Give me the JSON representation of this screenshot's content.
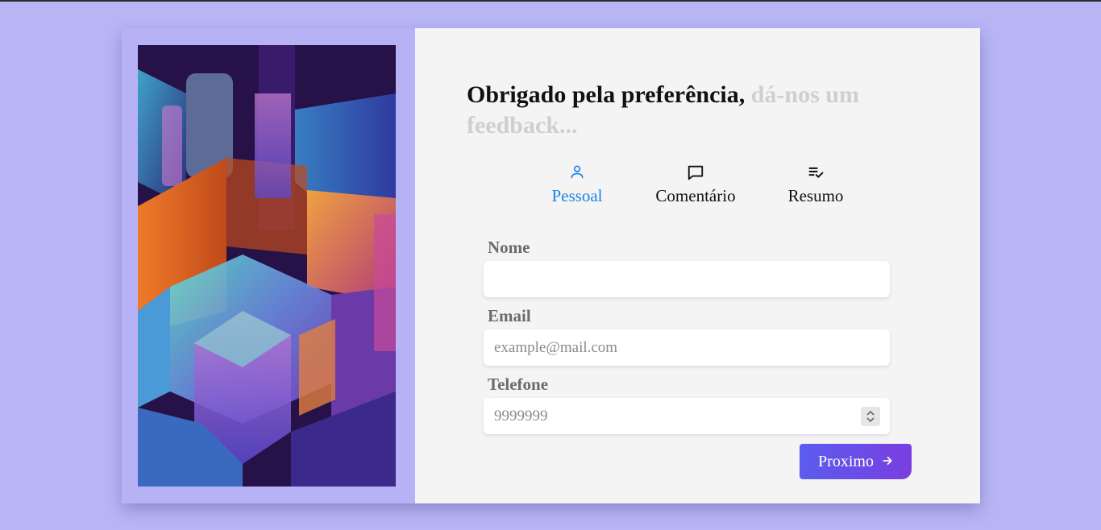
{
  "heading": {
    "main": "Obrigado pela preferência,",
    "sub": "dá-nos um feedback..."
  },
  "steps": [
    {
      "label": "Pessoal",
      "icon": "user-icon",
      "active": true
    },
    {
      "label": "Comentário",
      "icon": "chat-bubble-icon",
      "active": false
    },
    {
      "label": "Resumo",
      "icon": "list-check-icon",
      "active": false
    }
  ],
  "form": {
    "name": {
      "label": "Nome",
      "value": "",
      "placeholder": ""
    },
    "email": {
      "label": "Email",
      "value": "",
      "placeholder": "example@mail.com"
    },
    "phone": {
      "label": "Telefone",
      "value": "",
      "placeholder": "9999999"
    }
  },
  "next_button": {
    "label": "Proximo",
    "icon": "arrow-right-icon"
  },
  "colors": {
    "background": "#b8b5f6",
    "active_step": "#1a86e6",
    "button_gradient_start": "#5b5cee",
    "button_gradient_end": "#7a3ee0"
  }
}
